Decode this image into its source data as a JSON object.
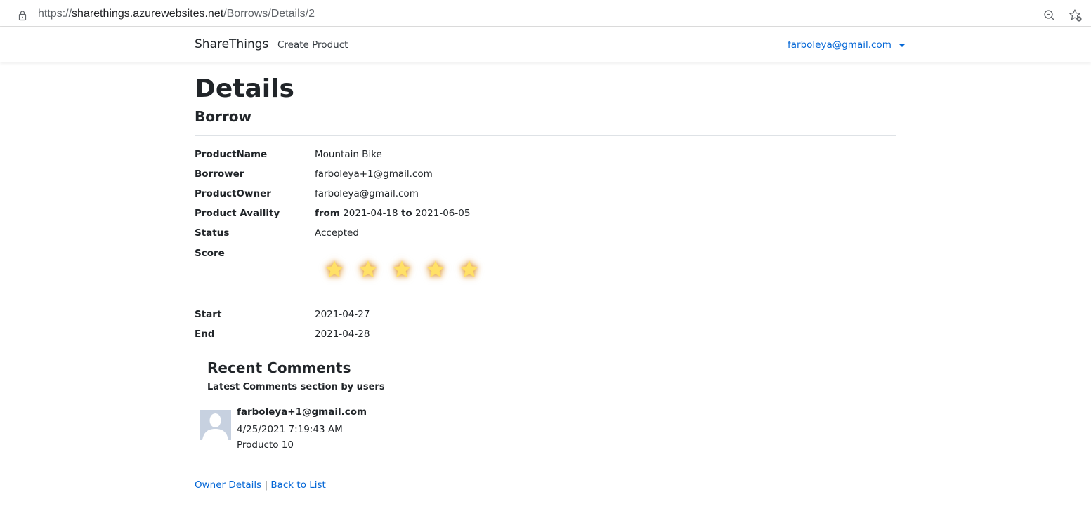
{
  "browser": {
    "url_scheme": "https://",
    "url_host": "sharethings.azurewebsites.net",
    "url_path": "/Borrows/Details/2"
  },
  "navbar": {
    "brand": "ShareThings",
    "create_product": "Create Product",
    "user_email": "farboleya@gmail.com"
  },
  "page": {
    "title": "Details",
    "subtitle": "Borrow"
  },
  "details": {
    "product_name": {
      "label": "ProductName",
      "value": "Mountain Bike"
    },
    "borrower": {
      "label": "Borrower",
      "value": "farboleya+1@gmail.com"
    },
    "product_owner": {
      "label": "ProductOwner",
      "value": "farboleya@gmail.com"
    },
    "availability": {
      "label": "Product Availity",
      "from_word": "from",
      "from_date": "2021-04-18",
      "to_word": "to",
      "to_date": "2021-06-05"
    },
    "status": {
      "label": "Status",
      "value": "Accepted"
    },
    "score": {
      "label": "Score",
      "stars": 5,
      "max_stars": 5,
      "star_color": "#ffe066"
    },
    "start": {
      "label": "Start",
      "value": "2021-04-27"
    },
    "end": {
      "label": "End",
      "value": "2021-04-28"
    }
  },
  "comments": {
    "title": "Recent Comments",
    "subtitle": "Latest Comments section by users",
    "items": [
      {
        "author": "farboleya+1@gmail.com",
        "date": "4/25/2021 7:19:43 AM",
        "text": "Producto 10"
      }
    ]
  },
  "footer": {
    "owner_details": "Owner Details",
    "separator": "|",
    "back_to_list": "Back to List"
  },
  "colors": {
    "link": "#0366d6",
    "text": "#212529",
    "avatar_bg": "#c7d1e0"
  }
}
